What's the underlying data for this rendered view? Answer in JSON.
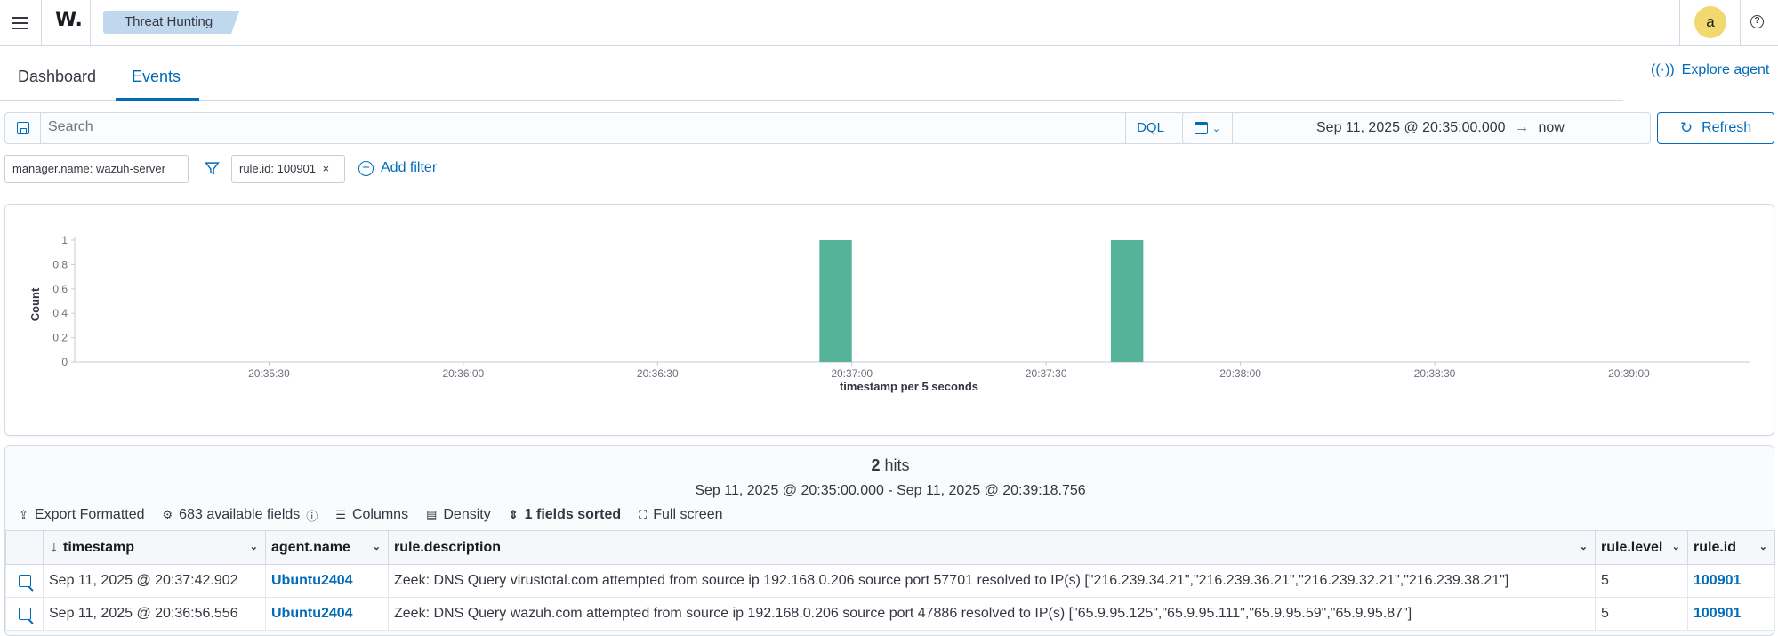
{
  "header": {
    "logo": "W.",
    "breadcrumb": "Threat Hunting",
    "avatar": "a",
    "help": "?"
  },
  "tabs": [
    {
      "label": "Dashboard",
      "active": false
    },
    {
      "label": "Events",
      "active": true
    }
  ],
  "explore_agent": "Explore agent",
  "search": {
    "placeholder": "Search",
    "language": "DQL"
  },
  "time": {
    "start": "Sep 11, 2025 @ 20:35:00.000",
    "arrow": "→",
    "end": "now",
    "refresh_label": "Refresh"
  },
  "filters": {
    "pinned": "manager.name: wazuh-server",
    "active": "rule.id: 100901",
    "remove": "×",
    "add_label": "Add filter"
  },
  "chart_data": {
    "type": "bar",
    "ylabel": "Count",
    "xlabel": "timestamp per 5 seconds",
    "ylim": [
      0,
      1
    ],
    "y_ticks": [
      "1",
      "0.8",
      "0.6",
      "0.4",
      "0.2",
      "0"
    ],
    "x_ticks": [
      "20:35:30",
      "20:36:00",
      "20:36:30",
      "20:37:00",
      "20:37:30",
      "20:38:00",
      "20:38:30",
      "20:39:00"
    ],
    "bars": [
      {
        "x": "20:36:55",
        "value": 1
      },
      {
        "x": "20:37:40",
        "value": 1
      }
    ],
    "bar_color": "#54b399"
  },
  "results": {
    "hits_count": "2",
    "hits_label": "hits",
    "range": "Sep 11, 2025 @ 20:35:00.000 - Sep 11, 2025 @ 20:39:18.756",
    "toolbar": {
      "export": "Export Formatted",
      "fields": "683 available fields",
      "columns": "Columns",
      "density": "Density",
      "sorted": "1 fields sorted",
      "fullscreen": "Full screen"
    },
    "columns": [
      "timestamp",
      "agent.name",
      "rule.description",
      "rule.level",
      "rule.id"
    ],
    "rows": [
      {
        "timestamp": "Sep 11, 2025 @ 20:37:42.902",
        "agent": "Ubuntu2404",
        "description": "Zeek: DNS Query virustotal.com attempted from source ip 192.168.0.206 source port 57701 resolved to IP(s) [\"216.239.34.21\",\"216.239.36.21\",\"216.239.32.21\",\"216.239.38.21\"]",
        "level": "5",
        "rule_id": "100901"
      },
      {
        "timestamp": "Sep 11, 2025 @ 20:36:56.556",
        "agent": "Ubuntu2404",
        "description": "Zeek: DNS Query wazuh.com attempted from source ip 192.168.0.206 source port 47886 resolved to IP(s) [\"65.9.95.125\",\"65.9.95.111\",\"65.9.95.59\",\"65.9.95.87\"]",
        "level": "5",
        "rule_id": "100901"
      }
    ]
  }
}
